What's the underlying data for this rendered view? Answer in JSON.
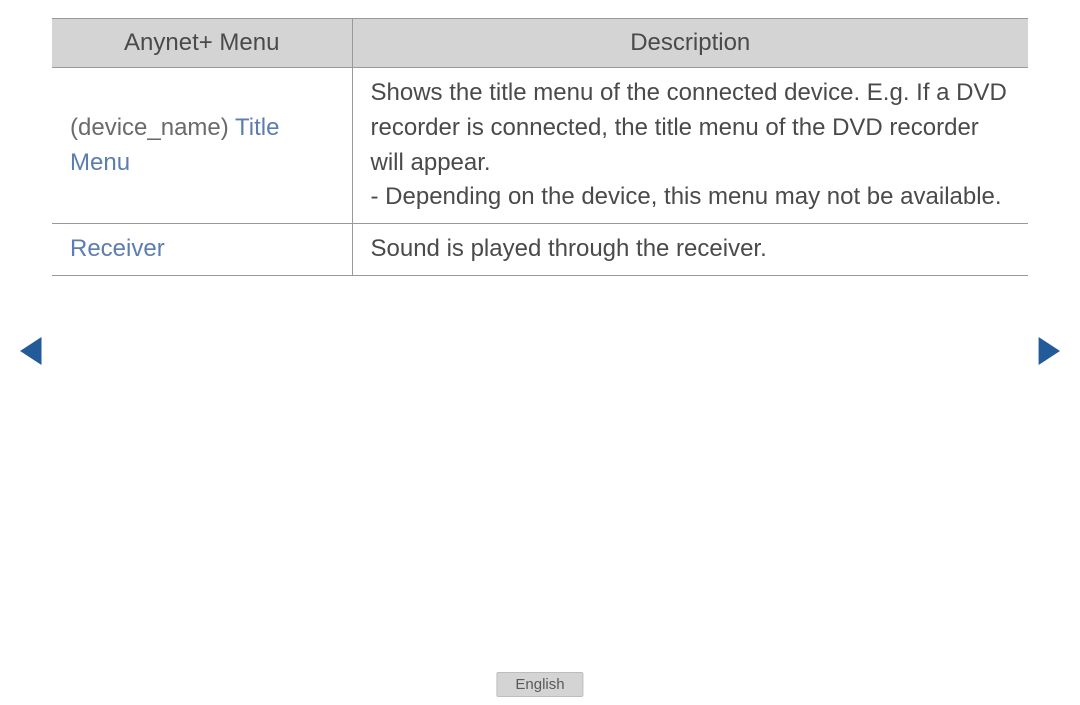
{
  "table": {
    "headers": {
      "menu": "Anynet+ Menu",
      "description": "Description"
    },
    "rows": [
      {
        "menu_prefix": "(device_name) ",
        "menu_accent": "Title Menu",
        "desc_main": "Shows the title menu of the connected device. E.g. If a DVD recorder is connected, the title menu of the DVD recorder will appear.",
        "desc_note_prefix": "- ",
        "desc_note": "Depending on the device, this menu may not be available."
      },
      {
        "menu_accent": "Receiver",
        "desc_main": "Sound is played through the receiver."
      }
    ]
  },
  "nav": {
    "prev_glyph": "◀",
    "next_glyph": "▶"
  },
  "footer": {
    "language": "English"
  }
}
